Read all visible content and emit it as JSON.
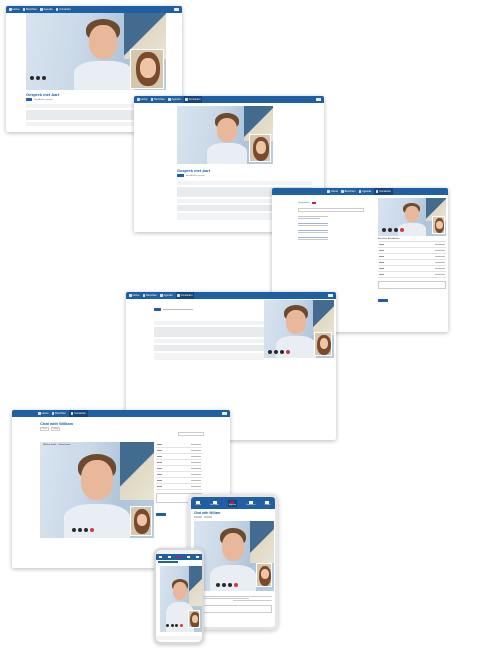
{
  "nav": {
    "home": "Home",
    "messages": "Berichten",
    "agenda": "Agenda",
    "contacts": "Contacten",
    "logo": "Logo"
  },
  "nav_tablet": [
    "Home",
    "Berichten",
    "Agenda",
    "Contacten",
    "Profiel"
  ],
  "screen1": {
    "title": "Gesprek met Aart",
    "subtitle": "Beeldbellen gestart"
  },
  "screen2": {
    "title": "Gesprek met Aart",
    "subtitle": "Beeldbellen gestart"
  },
  "screen3": {
    "list_heading": "Gesprekken",
    "right_heading": "Berichten Beeldbellen"
  },
  "screen5": {
    "title": "Chat with William",
    "subtitle": "William Smith - Joined room",
    "tab1": "Chat",
    "tab2": "Video"
  },
  "tablet": {
    "title": "Chat with William"
  },
  "colors": {
    "brand": "#1f5fa3",
    "hangup": "#d9363e"
  },
  "icons": [
    "home-icon",
    "messages-icon",
    "calendar-icon",
    "contacts-icon",
    "mic-icon",
    "camera-icon",
    "hangup-icon"
  ]
}
